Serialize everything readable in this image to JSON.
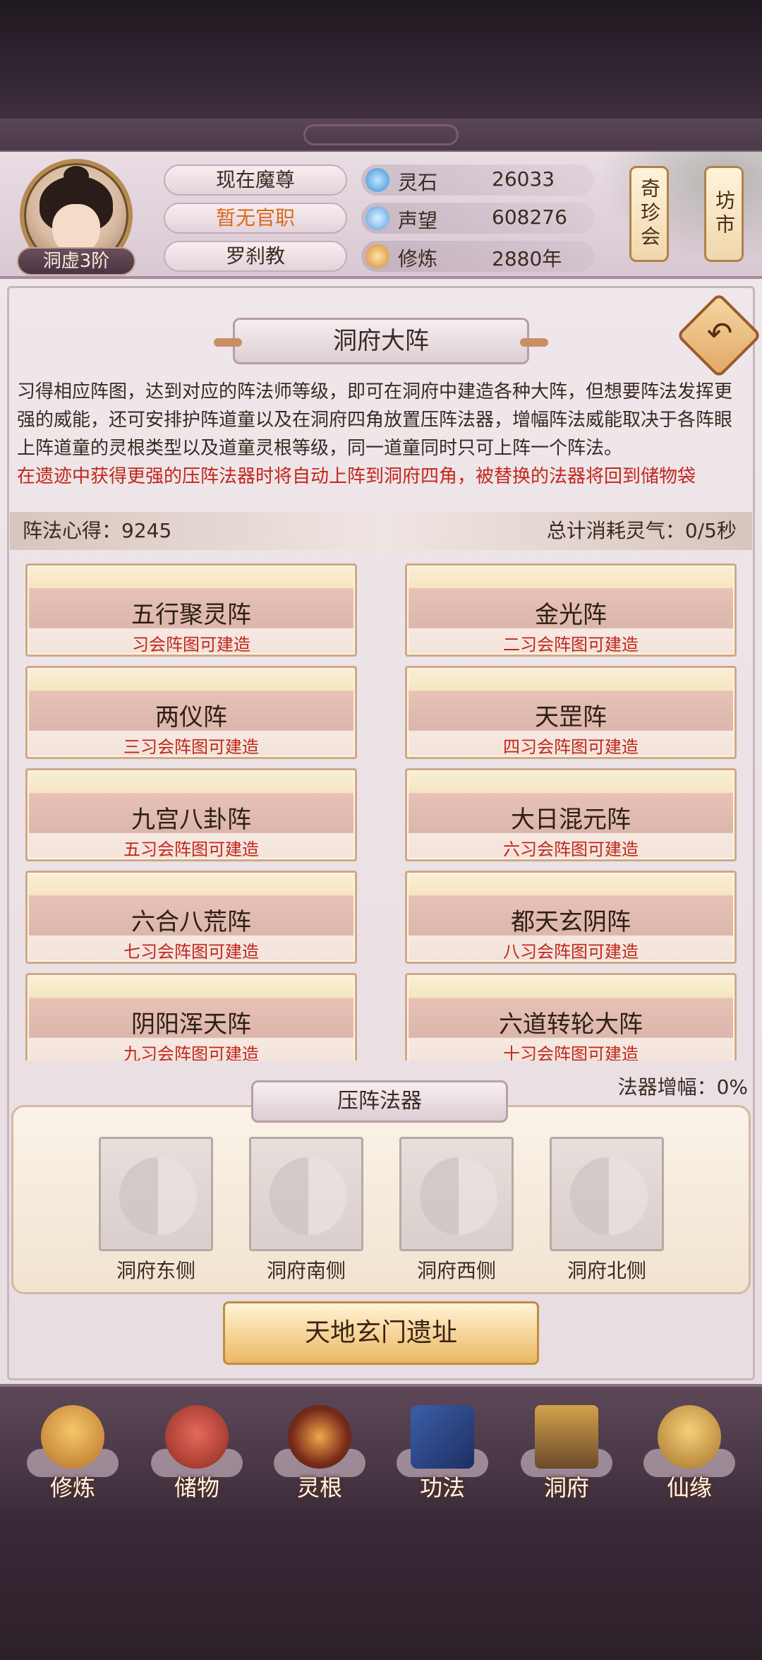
{
  "player": {
    "rank": "洞虚3阶",
    "title": "现在魔尊",
    "position": "暂无官职",
    "sect": "罗刹教"
  },
  "resources": [
    {
      "label": "灵石",
      "value": "26033",
      "icon": "spirit-stone-icon"
    },
    {
      "label": "声望",
      "value": "608276",
      "icon": "prestige-icon"
    },
    {
      "label": "修炼",
      "value": "2880年",
      "icon": "cultivation-icon"
    }
  ],
  "side_buttons": {
    "treasure": "奇珍会",
    "market": "坊市"
  },
  "page_title": "洞府大阵",
  "description": "习得相应阵图，达到对应的阵法师等级，即可在洞府中建造各种大阵，但想要阵法发挥更强的威能，还可安排护阵道童以及在洞府四角放置压阵法器，增幅阵法威能取决于各阵眼上阵道童的灵根类型以及道童灵根等级，同一道童同时只可上阵一个阵法。",
  "description_red": "在遗迹中获得更强的压阵法器时将自动上阵到洞府四角，被替换的法器将回到储物袋",
  "stats": {
    "insight": "阵法心得：9245",
    "consumption": "总计消耗灵气：0/5秒"
  },
  "formations": [
    {
      "name": "五行聚灵阵",
      "req": "习会阵图可建造"
    },
    {
      "name": "金光阵",
      "req": "二习会阵图可建造"
    },
    {
      "name": "两仪阵",
      "req": "三习会阵图可建造"
    },
    {
      "name": "天罡阵",
      "req": "四习会阵图可建造"
    },
    {
      "name": "九宫八卦阵",
      "req": "五习会阵图可建造"
    },
    {
      "name": "大日混元阵",
      "req": "六习会阵图可建造"
    },
    {
      "name": "六合八荒阵",
      "req": "七习会阵图可建造"
    },
    {
      "name": "都天玄阴阵",
      "req": "八习会阵图可建造"
    },
    {
      "name": "阴阳浑天阵",
      "req": "九习会阵图可建造"
    },
    {
      "name": "六道转轮大阵",
      "req": "十习会阵图可建造"
    }
  ],
  "artifacts": {
    "title": "压阵法器",
    "boost": "法器增幅：0%",
    "slots": [
      "洞府东侧",
      "洞府南侧",
      "洞府西侧",
      "洞府北侧"
    ]
  },
  "ruins_button": "天地玄门遗址",
  "nav": [
    {
      "label": "修炼",
      "icon": "cultivate-icon"
    },
    {
      "label": "储物",
      "icon": "storage-bag-icon"
    },
    {
      "label": "灵根",
      "icon": "spirit-root-icon"
    },
    {
      "label": "功法",
      "icon": "technique-book-icon"
    },
    {
      "label": "洞府",
      "icon": "cave-abode-icon"
    },
    {
      "label": "仙缘",
      "icon": "fate-gourd-icon"
    }
  ]
}
